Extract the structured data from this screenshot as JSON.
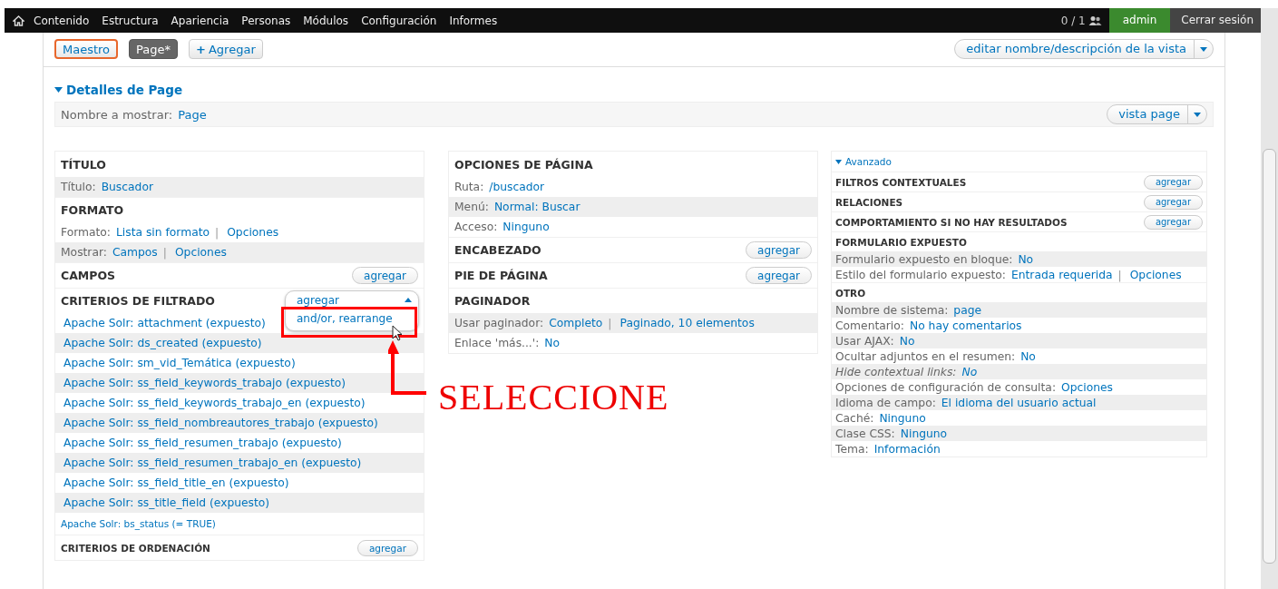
{
  "toolbar": {
    "menu": [
      "Contenido",
      "Estructura",
      "Apariencia",
      "Personas",
      "Módulos",
      "Configuración",
      "Informes"
    ],
    "users_online": "0 / 1",
    "user": "admin",
    "logout": "Cerrar sesión"
  },
  "display_tabs": [
    {
      "label": "Maestro",
      "selected": false,
      "focused": true
    },
    {
      "label": "Page*",
      "selected": true,
      "focused": false
    }
  ],
  "add_display": {
    "icon": "+",
    "label": "Agregar"
  },
  "edit_view_button": "editar nombre/descripción de la vista",
  "details": {
    "title": "Detalles de Page",
    "expanded": true,
    "display_name_label": "Nombre a mostrar:",
    "display_name": "Page",
    "view_button": "vista page"
  },
  "columns": [
    {
      "sections": [
        {
          "title": "TÍTULO",
          "rows": [
            {
              "label": "Título:",
              "links": [
                "Buscador"
              ],
              "shaded": true
            }
          ]
        },
        {
          "title": "FORMATO",
          "rows": [
            {
              "label": "Formato:",
              "links": [
                "Lista sin formato",
                "Opciones"
              ],
              "separator": "|",
              "shaded": false
            },
            {
              "label": "Mostrar:",
              "links": [
                "Campos",
                "Opciones"
              ],
              "separator": "|",
              "shaded": true
            }
          ]
        },
        {
          "title": "CAMPOS",
          "add": "agregar"
        },
        {
          "title": "CRITERIOS DE FILTRADO",
          "add": "agregar",
          "dropdown": {
            "expanded": true,
            "options": [
              "and/or, rearrange"
            ]
          },
          "rows": [
            {
              "links": [
                "Apache Solr: attachment (expuesto)"
              ],
              "shaded": false
            },
            {
              "links": [
                "Apache Solr: ds_created (expuesto)"
              ],
              "shaded": true
            },
            {
              "links": [
                "Apache Solr: sm_vid_Temática (expuesto)"
              ],
              "shaded": false
            },
            {
              "links": [
                "Apache Solr: ss_field_keywords_trabajo (expuesto)"
              ],
              "shaded": true
            },
            {
              "links": [
                "Apache Solr: ss_field_keywords_trabajo_en (expuesto)"
              ],
              "shaded": false
            },
            {
              "links": [
                "Apache Solr: ss_field_nombreautores_trabajo (expuesto)"
              ],
              "shaded": true
            },
            {
              "links": [
                "Apache Solr: ss_field_resumen_trabajo (expuesto)"
              ],
              "shaded": false
            },
            {
              "links": [
                "Apache Solr: ss_field_resumen_trabajo_en (expuesto)"
              ],
              "shaded": true
            },
            {
              "links": [
                "Apache Solr: ss_field_title_en (expuesto)"
              ],
              "shaded": false
            },
            {
              "links": [
                "Apache Solr: ss_title_field (expuesto)"
              ],
              "shaded": true
            },
            {
              "links": [
                "Apache Solr: bs_status (= TRUE)"
              ],
              "shaded": false,
              "compact": true
            }
          ]
        },
        {
          "title": "CRITERIOS DE ORDENACIÓN",
          "add": "agregar",
          "compact": true
        }
      ]
    },
    {
      "sections": [
        {
          "title": "OPCIONES DE PÁGINA",
          "rows": [
            {
              "label": "Ruta:",
              "links": [
                "/buscador"
              ],
              "shaded": false
            },
            {
              "label": "Menú:",
              "links": [
                "Normal: Buscar"
              ],
              "shaded": true
            },
            {
              "label": "Acceso:",
              "links": [
                "Ninguno"
              ],
              "shaded": false
            }
          ]
        },
        {
          "title": "ENCABEZADO",
          "add": "agregar"
        },
        {
          "title": "PIE DE PÁGINA",
          "add": "agregar"
        },
        {
          "title": "PAGINADOR",
          "rows": [
            {
              "label": "Usar paginador:",
              "links": [
                "Completo",
                "Paginado, 10 elementos"
              ],
              "separator": "|",
              "shaded": true
            },
            {
              "label": "Enlace 'más...':",
              "links": [
                "No"
              ],
              "shaded": false
            }
          ]
        }
      ]
    },
    {
      "compact": true,
      "toggle": "Avanzado",
      "sections": [
        {
          "title": "FILTROS CONTEXTUALES",
          "add": "agregar"
        },
        {
          "title": "RELACIONES",
          "add": "agregar"
        },
        {
          "title": "COMPORTAMIENTO SI NO HAY RESULTADOS",
          "add": "agregar"
        },
        {
          "title": "FORMULARIO EXPUESTO",
          "rows": [
            {
              "label": "Formulario expuesto en bloque:",
              "links": [
                "No"
              ],
              "shaded": true
            },
            {
              "label": "Estilo del formulario expuesto:",
              "links": [
                "Entrada requerida",
                "Opciones"
              ],
              "separator": "|",
              "shaded": false
            }
          ]
        },
        {
          "title": "OTRO",
          "rows": [
            {
              "label": "Nombre de sistema:",
              "links": [
                "page"
              ],
              "shaded": true
            },
            {
              "label": "Comentario:",
              "links": [
                "No hay comentarios"
              ],
              "shaded": false
            },
            {
              "label": "Usar AJAX:",
              "links": [
                "No"
              ],
              "shaded": true
            },
            {
              "label": "Ocultar adjuntos en el resumen:",
              "links": [
                "No"
              ],
              "shaded": false
            },
            {
              "label": "Hide contextual links:",
              "links": [
                "No"
              ],
              "shaded": true,
              "italic": true
            },
            {
              "label": "Opciones de configuración de consulta:",
              "links": [
                "Opciones"
              ],
              "shaded": false
            },
            {
              "label": "Idioma de campo:",
              "links": [
                "El idioma del usuario actual"
              ],
              "shaded": true
            },
            {
              "label": "Caché:",
              "links": [
                "Ninguno"
              ],
              "shaded": false
            },
            {
              "label": "Clase CSS:",
              "links": [
                "Ninguno"
              ],
              "shaded": true
            },
            {
              "label": "Tema:",
              "links": [
                "Información"
              ],
              "shaded": false
            }
          ]
        }
      ]
    }
  ],
  "annotation": {
    "label": "SELECCIONE"
  }
}
